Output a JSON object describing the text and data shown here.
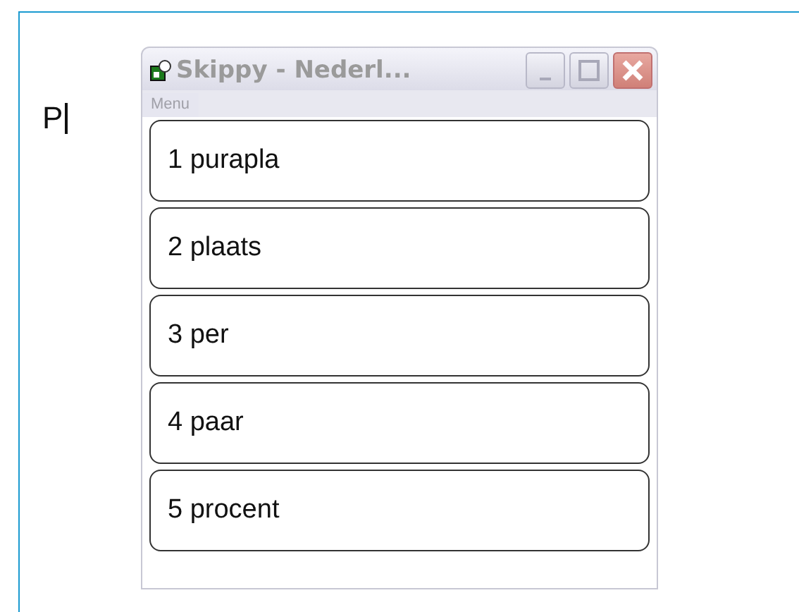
{
  "editor": {
    "text": "P"
  },
  "window": {
    "title": "Skippy - Nederl...",
    "menu": "Menu"
  },
  "suggestions": [
    {
      "label": "1 purapla"
    },
    {
      "label": "2 plaats"
    },
    {
      "label": "3 per"
    },
    {
      "label": "4 paar"
    },
    {
      "label": "5 procent"
    }
  ]
}
